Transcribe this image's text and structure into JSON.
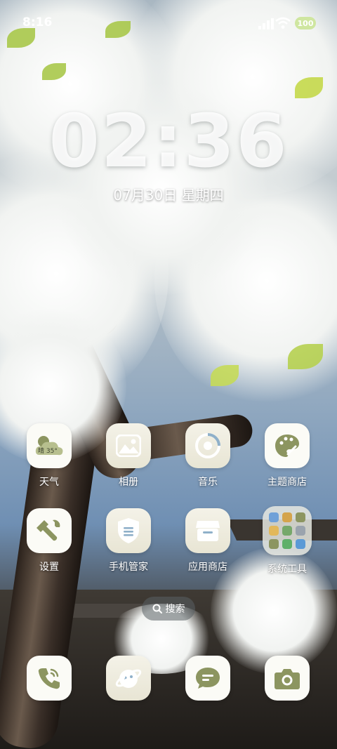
{
  "status": {
    "time": "8:16",
    "battery": "100"
  },
  "lock": {
    "clock": "02:36",
    "date": "07月30日  星期四"
  },
  "weather_icon": {
    "text": "晴 35°"
  },
  "apps": [
    {
      "label": "天气",
      "icon": "weather-icon"
    },
    {
      "label": "相册",
      "icon": "gallery-icon"
    },
    {
      "label": "音乐",
      "icon": "music-icon"
    },
    {
      "label": "主题商店",
      "icon": "theme-store-icon"
    },
    {
      "label": "设置",
      "icon": "settings-icon"
    },
    {
      "label": "手机管家",
      "icon": "phone-manager-icon"
    },
    {
      "label": "应用商店",
      "icon": "app-store-icon"
    },
    {
      "label": "系统工具",
      "icon": "system-tools-folder-icon"
    }
  ],
  "search": {
    "label": "搜索"
  },
  "dock": [
    {
      "icon": "phone-icon"
    },
    {
      "icon": "browser-icon"
    },
    {
      "icon": "messages-icon"
    },
    {
      "icon": "camera-icon"
    }
  ],
  "colors": {
    "icon_accent": "#8c9560",
    "icon_bg": "#fbfbf6"
  }
}
